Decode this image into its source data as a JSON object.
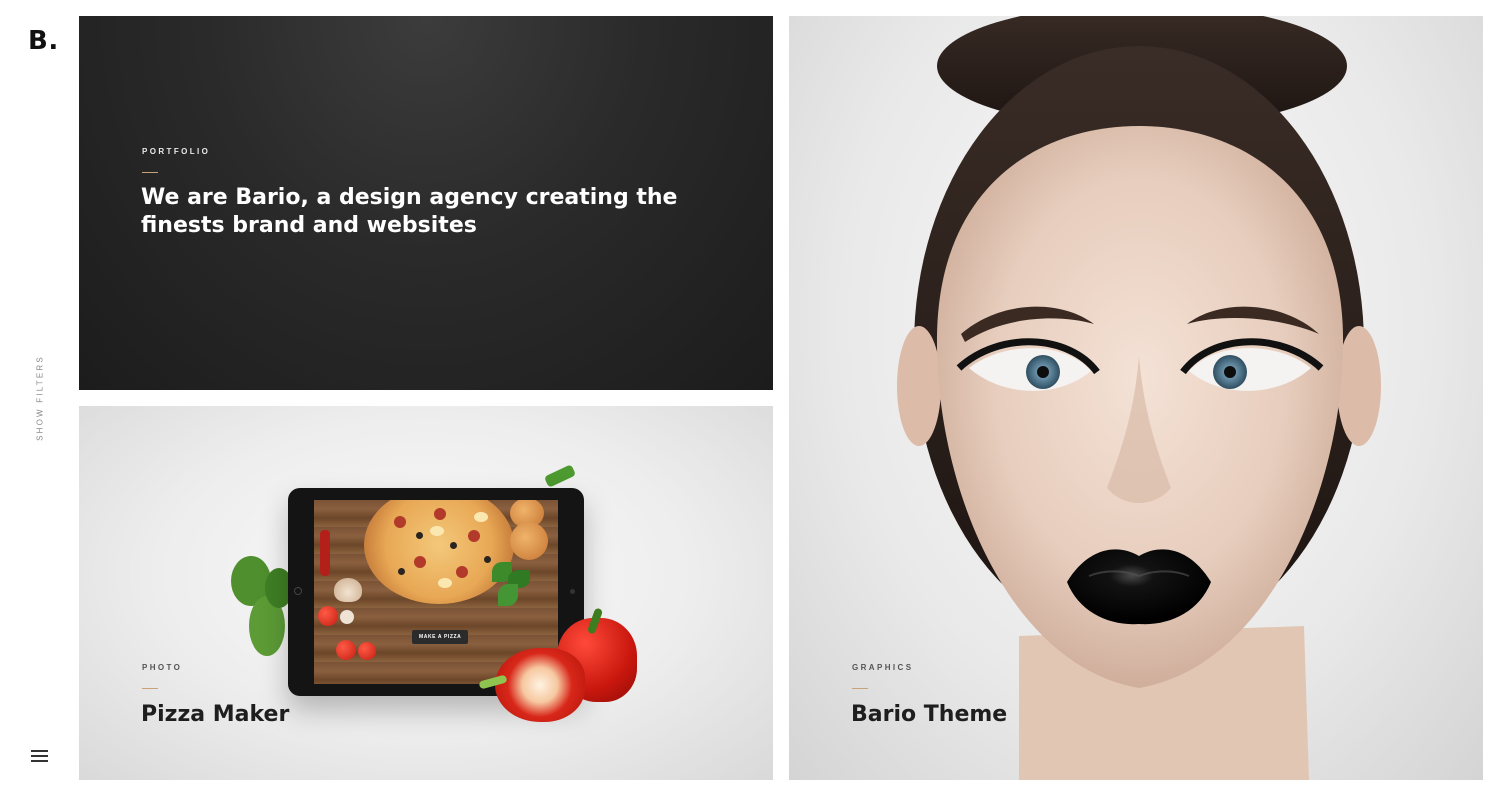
{
  "brand": {
    "logo": "B."
  },
  "sidebar": {
    "filters_label": "SHOW FILTERS",
    "menu_icon": "hamburger-menu-icon"
  },
  "tiles": {
    "intro": {
      "category": "PORTFOLIO",
      "title": "We are Bario, a design agency creating the finests brand and websites"
    },
    "pizza": {
      "category": "PHOTO",
      "title": "Pizza Maker",
      "screen_button": "MAKE A PIZZA"
    },
    "bario": {
      "category": "GRAPHICS",
      "title": "Bario Theme"
    }
  },
  "colors": {
    "accent_rule": "#c9a27a",
    "dark_tile": "#1f1f1f",
    "light_tile": "#e9e9e9"
  }
}
